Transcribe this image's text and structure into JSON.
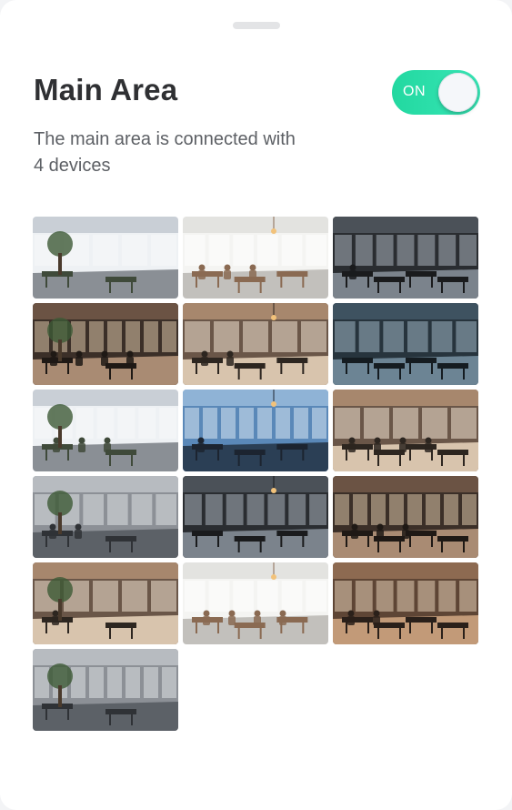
{
  "header": {
    "title": "Main Area",
    "subtitle": "The main area is connected with 4 devices"
  },
  "toggle": {
    "label": "ON",
    "state": true,
    "color": "#2ddca8"
  },
  "gallery": {
    "photos": [
      {
        "name": "photo-office-plant-window",
        "theme": "bright"
      },
      {
        "name": "photo-white-desk-room",
        "theme": "white"
      },
      {
        "name": "photo-dark-loft-windows",
        "theme": "dark"
      },
      {
        "name": "photo-meeting-room-people",
        "theme": "warm-dark"
      },
      {
        "name": "photo-open-office-pendant-lights",
        "theme": "warm"
      },
      {
        "name": "photo-dark-corridor-office",
        "theme": "blue-dark"
      },
      {
        "name": "photo-desk-computer-city-view",
        "theme": "bright"
      },
      {
        "name": "photo-glass-wall-skyline",
        "theme": "blue"
      },
      {
        "name": "photo-team-laptops-table",
        "theme": "warm"
      },
      {
        "name": "photo-large-open-office",
        "theme": "grey"
      },
      {
        "name": "photo-dark-office-people",
        "theme": "dark"
      },
      {
        "name": "photo-presentation-table",
        "theme": "warm-dark"
      },
      {
        "name": "photo-busy-coworking",
        "theme": "warm"
      },
      {
        "name": "photo-white-office-rows",
        "theme": "white"
      },
      {
        "name": "photo-wooden-slats-office",
        "theme": "wood"
      },
      {
        "name": "photo-glass-door-hallway",
        "theme": "grey"
      }
    ]
  }
}
